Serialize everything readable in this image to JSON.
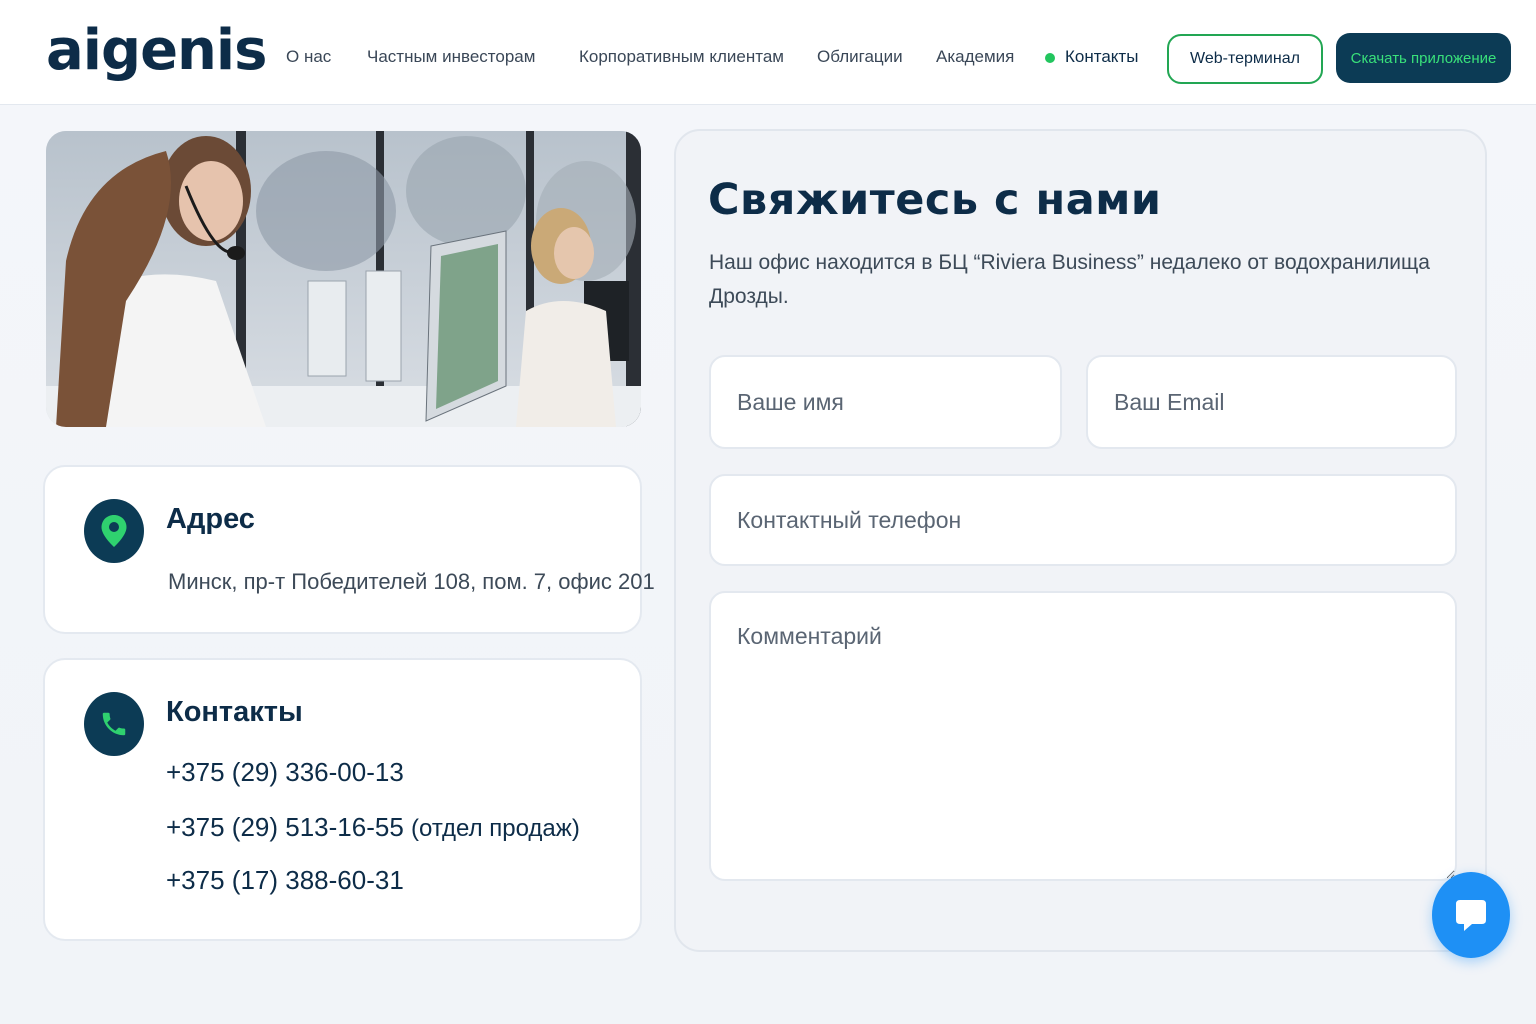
{
  "header": {
    "logo": "aigenis",
    "nav": [
      {
        "label": "О нас"
      },
      {
        "label": "Частным инвесторам"
      },
      {
        "label": "Корпоративным клиентам"
      },
      {
        "label": "Облигации"
      },
      {
        "label": "Академия"
      },
      {
        "label": "Контакты",
        "active": true
      }
    ],
    "web_terminal_label": "Web-терминал",
    "download_label": "Скачать приложение"
  },
  "address_card": {
    "title": "Адрес",
    "text": "Минск, пр-т Победителей 108, пом. 7, офис 201",
    "icon": "location-pin-icon"
  },
  "contacts_card": {
    "title": "Контакты",
    "icon": "phone-icon",
    "phones": [
      {
        "number": "+375 (29) 336-00-13",
        "note": ""
      },
      {
        "number": "+375 (29) 513-16-55",
        "note": "(отдел продаж)"
      },
      {
        "number": "+375 (17) 388-60-31",
        "note": ""
      }
    ]
  },
  "form": {
    "title": "Свяжитесь с нами",
    "description": "Наш офис находится в БЦ “Riviera Business” недалеко от водохранилища Дрозды.",
    "name_placeholder": "Ваше имя",
    "email_placeholder": "Ваш Email",
    "phone_placeholder": "Контактный телефон",
    "comment_placeholder": "Комментарий"
  },
  "colors": {
    "brand_dark": "#0c3b55",
    "accent_green": "#22c55e",
    "chat_blue": "#1e90f5"
  }
}
